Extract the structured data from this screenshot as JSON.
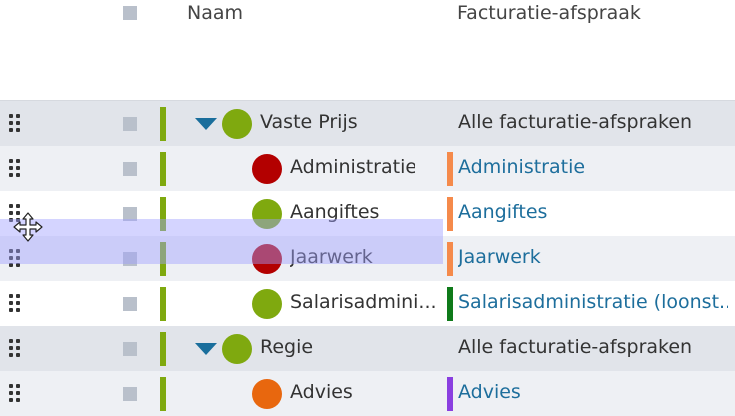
{
  "header": {
    "name_label": "Naam",
    "billing_label": "Facturatie-afspraak"
  },
  "rows": [
    {
      "type": "group",
      "name": "Vaste Prijs",
      "status_color": "#7fa90f",
      "billing": "Alle facturatie-afspraken"
    },
    {
      "type": "item",
      "name": "Administratie",
      "status_color": "#b30000",
      "billing": "Administratie",
      "billing_color": "#f58a4b"
    },
    {
      "type": "item",
      "name": "Aangiftes",
      "status_color": "#7fa90f",
      "billing": "Aangiftes",
      "billing_color": "#f58a4b"
    },
    {
      "type": "item",
      "name": "Jaarwerk",
      "status_color": "#b30000",
      "billing": "Jaarwerk",
      "billing_color": "#f58a4b"
    },
    {
      "type": "item",
      "name": "Salarisadmini...",
      "status_color": "#7fa90f",
      "billing": "Salarisadministratie (loonst...",
      "billing_color": "#0f7a1a"
    },
    {
      "type": "group",
      "name": "Regie",
      "status_color": "#7fa90f",
      "billing": "Alle facturatie-afspraken"
    },
    {
      "type": "item",
      "name": "Advies",
      "status_color": "#e8670e",
      "billing": "Advies",
      "billing_color": "#8a3fe0"
    }
  ],
  "colors": {
    "row_bar": "#7fa90f",
    "link": "#1d6e9c",
    "expand_arrow": "#1a6e9c"
  },
  "icons": {
    "drag_handle": "grip-dots-icon",
    "expand": "caret-down-icon",
    "cursor": "move-cursor-icon"
  }
}
